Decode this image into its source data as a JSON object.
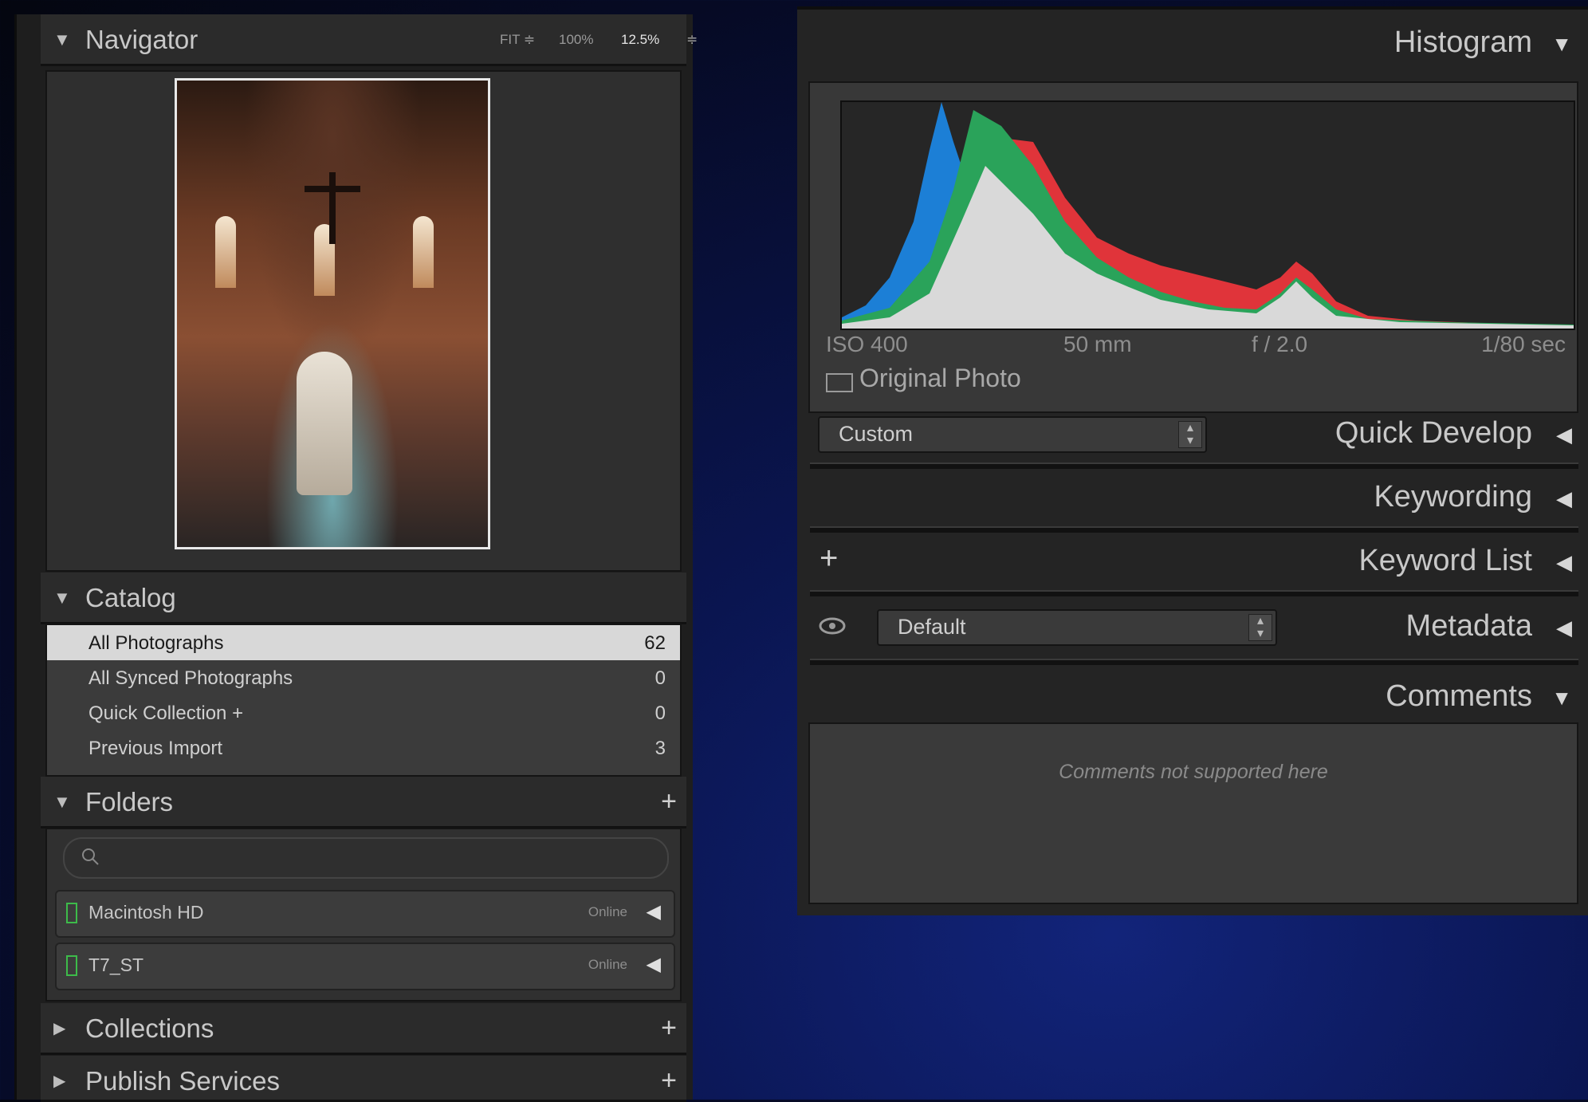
{
  "left_panel": {
    "navigator": {
      "title": "Navigator",
      "zoom_fit": "FIT ≑",
      "zoom_100": "100%",
      "zoom_value": "12.5%",
      "zoom_spinner": "≑"
    },
    "catalog": {
      "title": "Catalog",
      "items": [
        {
          "label": "All Photographs",
          "count": "62",
          "selected": true
        },
        {
          "label": "All Synced Photographs",
          "count": "0"
        },
        {
          "label": "Quick Collection +",
          "count": "0"
        },
        {
          "label": "Previous Import",
          "count": "3"
        }
      ]
    },
    "folders": {
      "title": "Folders",
      "add": "+",
      "search_icon": "magnifier-icon",
      "volumes": [
        {
          "name": "Macintosh HD",
          "status": "Online",
          "arrow": "◀"
        },
        {
          "name": "T7_ST",
          "status": "Online",
          "arrow": "◀"
        }
      ]
    },
    "collections": {
      "title": "Collections",
      "add": "+"
    },
    "publish": {
      "title": "Publish Services",
      "add": "+"
    }
  },
  "right_panel": {
    "histogram": {
      "title": "Histogram",
      "arrow": "▼",
      "exif": {
        "iso": "ISO 400",
        "focal": "50 mm",
        "aperture": "f / 2.0",
        "shutter": "1/80 sec"
      },
      "original_photo": "Original Photo",
      "colors": {
        "blue": "#1c7fd6",
        "green": "#2aa35a",
        "red": "#e0343a",
        "luma": "#d9d9d9"
      }
    },
    "quick_develop": {
      "title": "Quick Develop",
      "preset": "Custom",
      "arrow": "◀"
    },
    "keywording": {
      "title": "Keywording",
      "arrow": "◀"
    },
    "keyword_list": {
      "title": "Keyword List",
      "add": "+",
      "arrow": "◀"
    },
    "metadata": {
      "title": "Metadata",
      "preset": "Default",
      "arrow": "◀",
      "eye_icon": "eye-icon"
    },
    "comments": {
      "title": "Comments",
      "arrow": "▼",
      "message": "Comments not supported here"
    }
  }
}
